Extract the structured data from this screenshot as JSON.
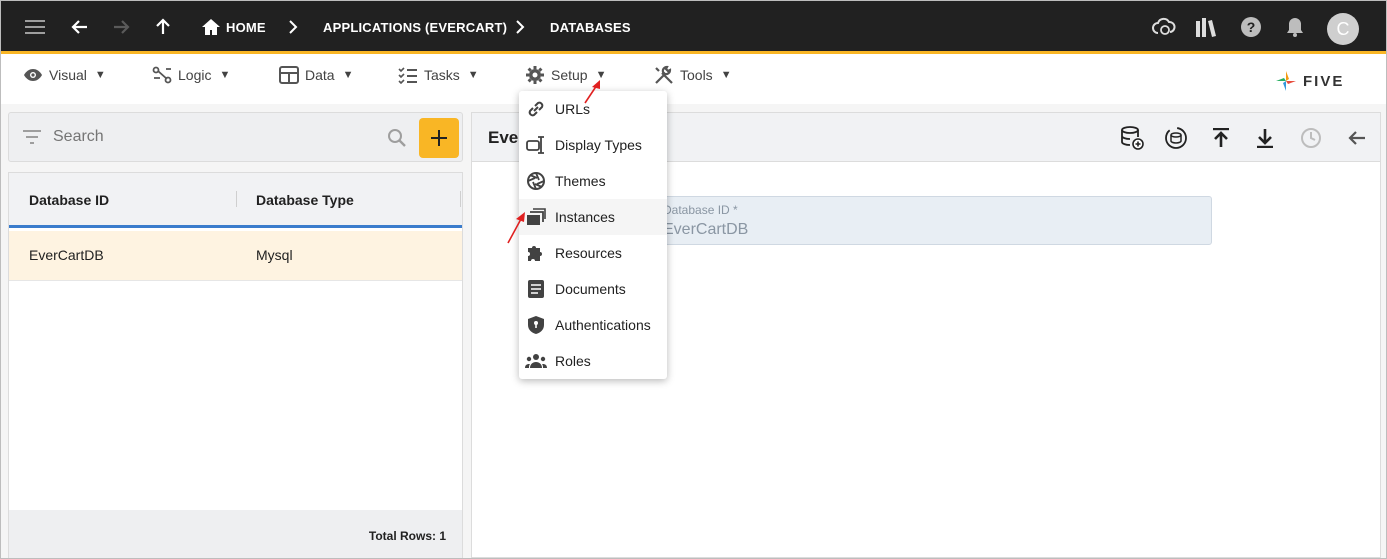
{
  "topbar": {
    "breadcrumbs": [
      "HOME",
      "APPLICATIONS (EVERCART)",
      "DATABASES"
    ],
    "avatar_initial": "C",
    "accent_color": "#f9b625"
  },
  "menubar": {
    "items": [
      {
        "label": "Visual",
        "icon": "eye-icon"
      },
      {
        "label": "Logic",
        "icon": "flow-icon"
      },
      {
        "label": "Data",
        "icon": "table-icon"
      },
      {
        "label": "Tasks",
        "icon": "checklist-icon"
      },
      {
        "label": "Setup",
        "icon": "gear-icon"
      },
      {
        "label": "Tools",
        "icon": "tools-icon"
      }
    ],
    "logo_text": "FIVE"
  },
  "left": {
    "search_placeholder": "Search",
    "columns": [
      "Database ID",
      "Database Type"
    ],
    "rows": [
      {
        "id": "EverCartDB",
        "type": "Mysql"
      }
    ],
    "total_rows": "Total Rows: 1"
  },
  "right": {
    "title": "Ever",
    "field_label": "Database ID *",
    "field_value": "EverCartDB"
  },
  "setup_menu": {
    "items": [
      {
        "label": "URLs",
        "icon": "link-icon"
      },
      {
        "label": "Display Types",
        "icon": "display-types-icon"
      },
      {
        "label": "Themes",
        "icon": "aperture-icon"
      },
      {
        "label": "Instances",
        "icon": "instances-icon"
      },
      {
        "label": "Resources",
        "icon": "puzzle-icon"
      },
      {
        "label": "Documents",
        "icon": "document-icon"
      },
      {
        "label": "Authentications",
        "icon": "shield-icon"
      },
      {
        "label": "Roles",
        "icon": "people-icon"
      }
    ],
    "highlighted": "Instances"
  }
}
